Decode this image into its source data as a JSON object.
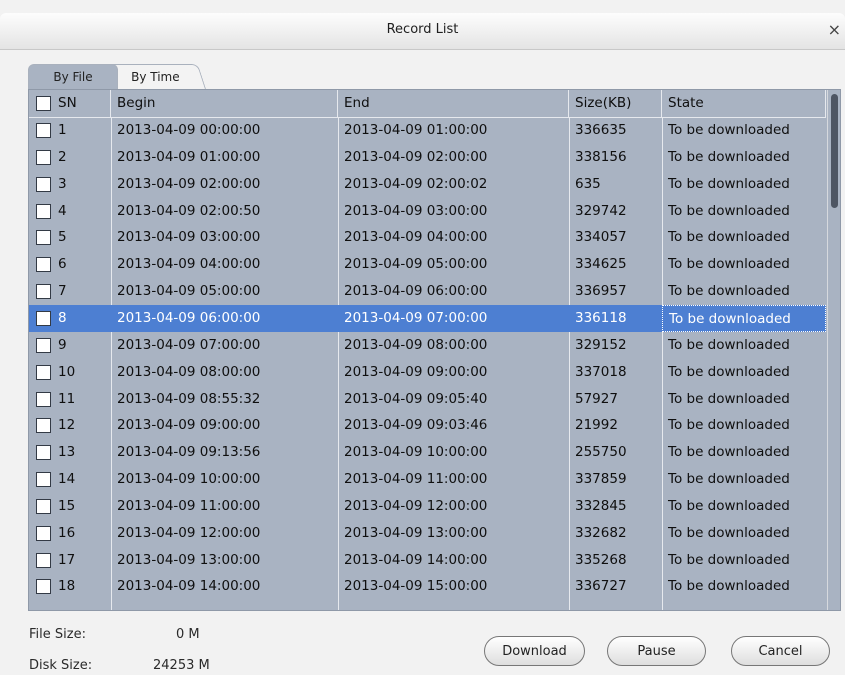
{
  "window": {
    "title": "Record List",
    "close_glyph": "×"
  },
  "tabs": [
    {
      "label": "By File",
      "active": true
    },
    {
      "label": "By Time",
      "active": false
    }
  ],
  "table": {
    "columns": [
      "SN",
      "Begin",
      "End",
      "Size(KB)",
      "State"
    ],
    "rows": [
      {
        "sn": "1",
        "begin": "2013-04-09 00:00:00",
        "end": "2013-04-09 01:00:00",
        "size": "336635",
        "state": "To be downloaded"
      },
      {
        "sn": "2",
        "begin": "2013-04-09 01:00:00",
        "end": "2013-04-09 02:00:00",
        "size": "338156",
        "state": "To be downloaded"
      },
      {
        "sn": "3",
        "begin": "2013-04-09 02:00:00",
        "end": "2013-04-09 02:00:02",
        "size": "635",
        "state": "To be downloaded"
      },
      {
        "sn": "4",
        "begin": "2013-04-09 02:00:50",
        "end": "2013-04-09 03:00:00",
        "size": "329742",
        "state": "To be downloaded"
      },
      {
        "sn": "5",
        "begin": "2013-04-09 03:00:00",
        "end": "2013-04-09 04:00:00",
        "size": "334057",
        "state": "To be downloaded"
      },
      {
        "sn": "6",
        "begin": "2013-04-09 04:00:00",
        "end": "2013-04-09 05:00:00",
        "size": "334625",
        "state": "To be downloaded"
      },
      {
        "sn": "7",
        "begin": "2013-04-09 05:00:00",
        "end": "2013-04-09 06:00:00",
        "size": "336957",
        "state": "To be downloaded"
      },
      {
        "sn": "8",
        "begin": "2013-04-09 06:00:00",
        "end": "2013-04-09 07:00:00",
        "size": "336118",
        "state": "To be downloaded"
      },
      {
        "sn": "9",
        "begin": "2013-04-09 07:00:00",
        "end": "2013-04-09 08:00:00",
        "size": "329152",
        "state": "To be downloaded"
      },
      {
        "sn": "10",
        "begin": "2013-04-09 08:00:00",
        "end": "2013-04-09 09:00:00",
        "size": "337018",
        "state": "To be downloaded"
      },
      {
        "sn": "11",
        "begin": "2013-04-09 08:55:32",
        "end": "2013-04-09 09:05:40",
        "size": "57927",
        "state": "To be downloaded"
      },
      {
        "sn": "12",
        "begin": "2013-04-09 09:00:00",
        "end": "2013-04-09 09:03:46",
        "size": "21992",
        "state": "To be downloaded"
      },
      {
        "sn": "13",
        "begin": "2013-04-09 09:13:56",
        "end": "2013-04-09 10:00:00",
        "size": "255750",
        "state": "To be downloaded"
      },
      {
        "sn": "14",
        "begin": "2013-04-09 10:00:00",
        "end": "2013-04-09 11:00:00",
        "size": "337859",
        "state": "To be downloaded"
      },
      {
        "sn": "15",
        "begin": "2013-04-09 11:00:00",
        "end": "2013-04-09 12:00:00",
        "size": "332845",
        "state": "To be downloaded"
      },
      {
        "sn": "16",
        "begin": "2013-04-09 12:00:00",
        "end": "2013-04-09 13:00:00",
        "size": "332682",
        "state": "To be downloaded"
      },
      {
        "sn": "17",
        "begin": "2013-04-09 13:00:00",
        "end": "2013-04-09 14:00:00",
        "size": "335268",
        "state": "To be downloaded"
      },
      {
        "sn": "18",
        "begin": "2013-04-09 14:00:00",
        "end": "2013-04-09 15:00:00",
        "size": "336727",
        "state": "To be downloaded"
      }
    ],
    "selected_sn": "8"
  },
  "footer": {
    "file_size_label": "File Size:",
    "file_size_value": "0 M",
    "disk_size_label": "Disk Size:",
    "disk_size_value": "24253 M"
  },
  "buttons": {
    "download": "Download",
    "pause": "Pause",
    "cancel": "Cancel"
  },
  "colors": {
    "grid_bg": "#a9b3c2",
    "selected_row": "#4d7fd2",
    "window_bg": "#f2f2f2"
  }
}
